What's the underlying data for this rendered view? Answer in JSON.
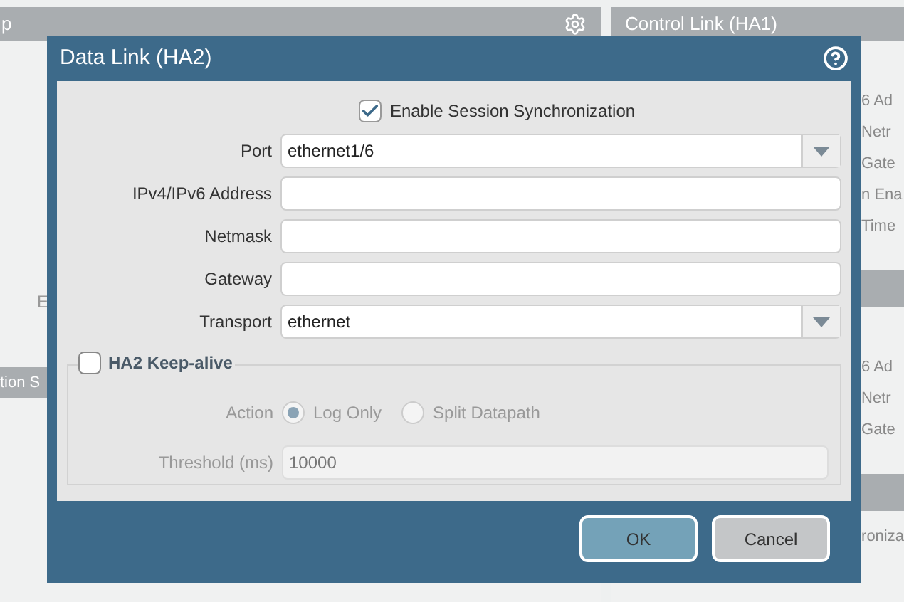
{
  "background": {
    "left_panel": {
      "title": "p",
      "fragment": "E",
      "section_title": "tion S"
    },
    "right_panel": {
      "title": "Control Link (HA1)",
      "rows_a": [
        "6 Ad",
        "Netr",
        "Gate",
        "n Ena",
        "Time"
      ],
      "rows_b": [
        "6 Ad",
        "Netr",
        "Gate"
      ],
      "footer": "roniza"
    }
  },
  "dialog": {
    "title": "Data Link (HA2)",
    "enable_sync": {
      "label": "Enable Session Synchronization",
      "checked": true
    },
    "fields": [
      {
        "kind": "select",
        "label": "Port",
        "value": "ethernet1/6"
      },
      {
        "kind": "text",
        "label": "IPv4/IPv6 Address"
      },
      {
        "kind": "text",
        "label": "Netmask"
      },
      {
        "kind": "text",
        "label": "Gateway"
      },
      {
        "kind": "select",
        "label": "Transport",
        "value": "ethernet"
      }
    ],
    "keep_alive": {
      "label": "HA2 Keep-alive",
      "checked": false,
      "action_label": "Action",
      "actions": [
        {
          "label": "Log Only",
          "selected": true
        },
        {
          "label": "Split Datapath",
          "selected": false
        }
      ],
      "threshold_label": "Threshold (ms)",
      "threshold": "10000"
    },
    "buttons": [
      {
        "label": "OK",
        "kind": "primary"
      },
      {
        "label": "Cancel",
        "kind": "secondary"
      }
    ]
  }
}
